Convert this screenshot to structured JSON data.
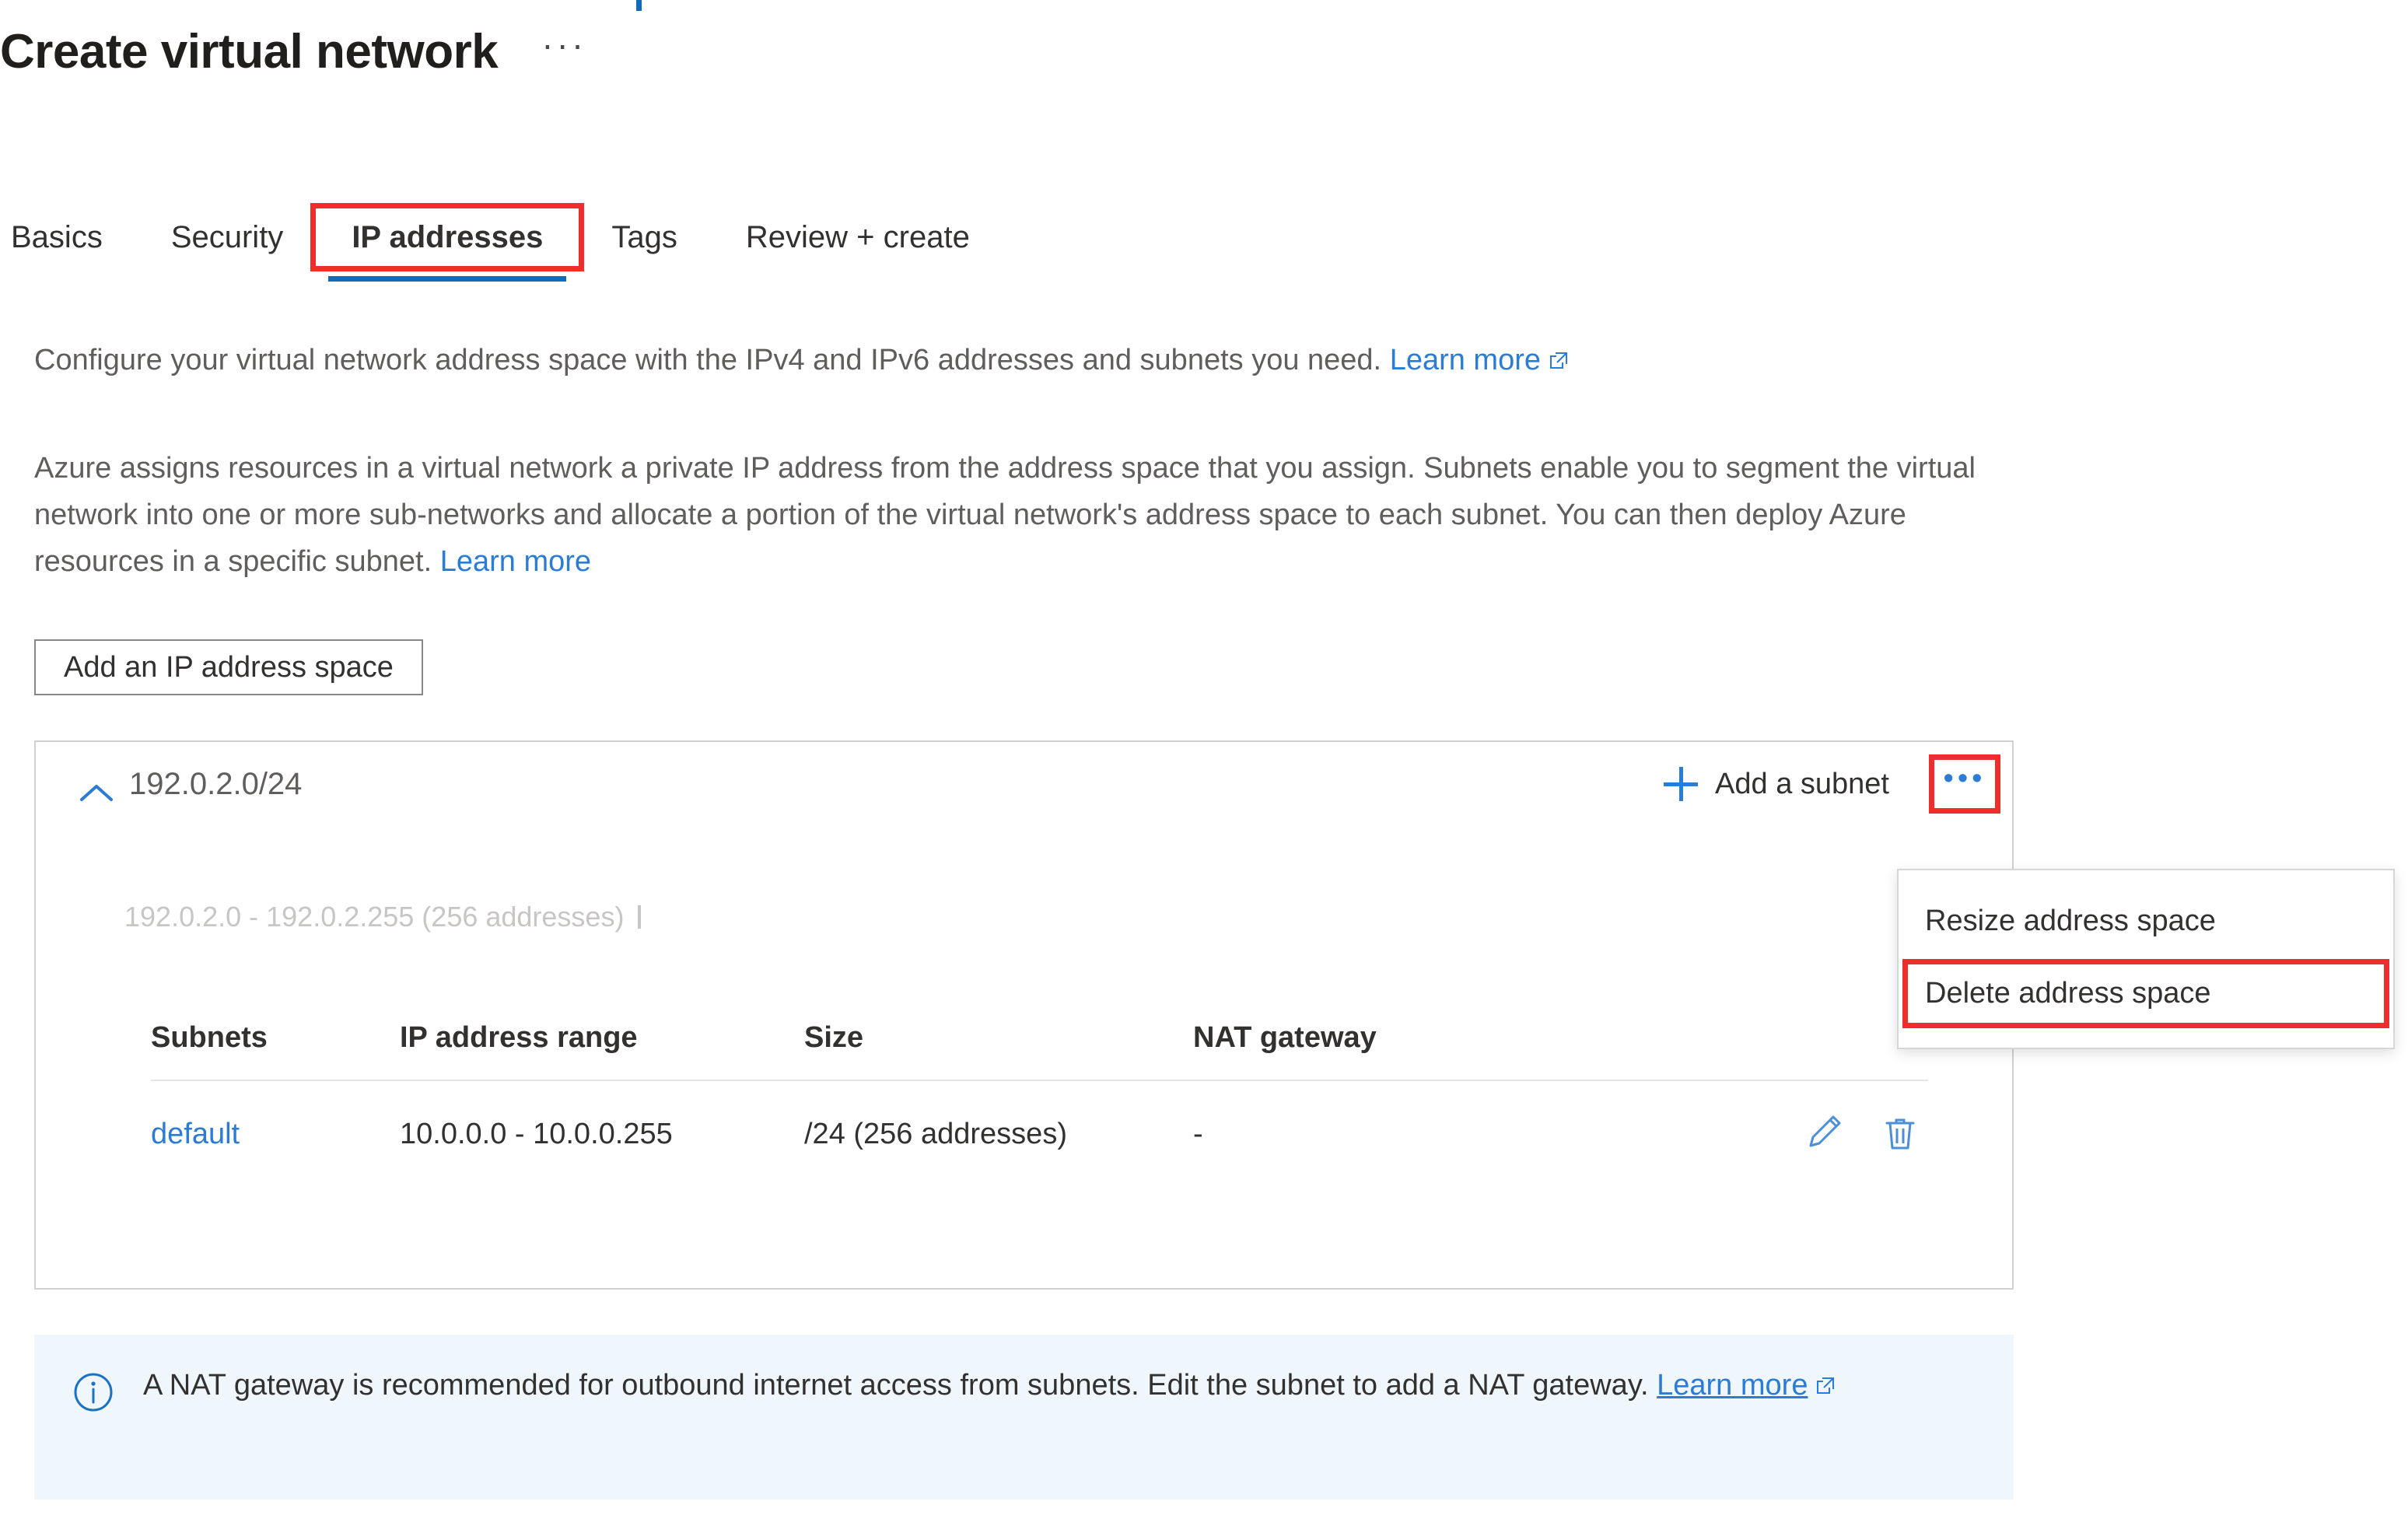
{
  "header": {
    "title": "Create virtual network",
    "more_menu": "···"
  },
  "tabs": [
    {
      "label": "Basics",
      "selected": false,
      "highlighted": false
    },
    {
      "label": "Security",
      "selected": false,
      "highlighted": false
    },
    {
      "label": "IP addresses",
      "selected": true,
      "highlighted": true
    },
    {
      "label": "Tags",
      "selected": false,
      "highlighted": false
    },
    {
      "label": "Review + create",
      "selected": false,
      "highlighted": false
    }
  ],
  "description": {
    "line1_text": "Configure your virtual network address space with the IPv4 and IPv6 addresses and subnets you need.",
    "line1_link": "Learn more",
    "paragraph": "Azure assigns resources in a virtual network a private IP address from the address space that you assign. Subnets enable you to segment the virtual network into one or more sub-networks and allocate a portion of the virtual network's address space to each subnet. You can then deploy Azure resources in a specific subnet.",
    "paragraph_link": "Learn more"
  },
  "toolbar": {
    "add_ip_address_space": "Add an IP address space"
  },
  "address_space": {
    "cidr": "192.0.2.0/24",
    "range_label": "192.0.2.0 - 192.0.2.255 (256 addresses)",
    "add_subnet_label": "Add a subnet",
    "overflow_label": "•••",
    "collapse_icon": "chevron-up-icon"
  },
  "context_menu": {
    "items": [
      {
        "label": "Resize address space",
        "highlighted": false
      },
      {
        "label": "Delete address space",
        "highlighted": true
      }
    ]
  },
  "subnets_table": {
    "columns": [
      "Subnets",
      "IP address range",
      "Size",
      "NAT gateway"
    ],
    "rows": [
      {
        "name": "default",
        "ip_address_range": "10.0.0.0 - 10.0.0.255",
        "size": "/24 (256 addresses)",
        "nat_gateway": "-",
        "edit_icon": "pencil-icon",
        "delete_icon": "trash-icon"
      }
    ]
  },
  "info_bar": {
    "icon": "info-circle-icon",
    "text": "A NAT gateway is recommended for outbound internet access from subnets. Edit the subnet to add a NAT gateway.",
    "link": "Learn more"
  },
  "colors": {
    "accent": "#0f6cbd",
    "link": "#2a7cd6",
    "highlight": "#f02d2d",
    "info_bg": "#eff6fc",
    "muted": "#605e5c"
  }
}
